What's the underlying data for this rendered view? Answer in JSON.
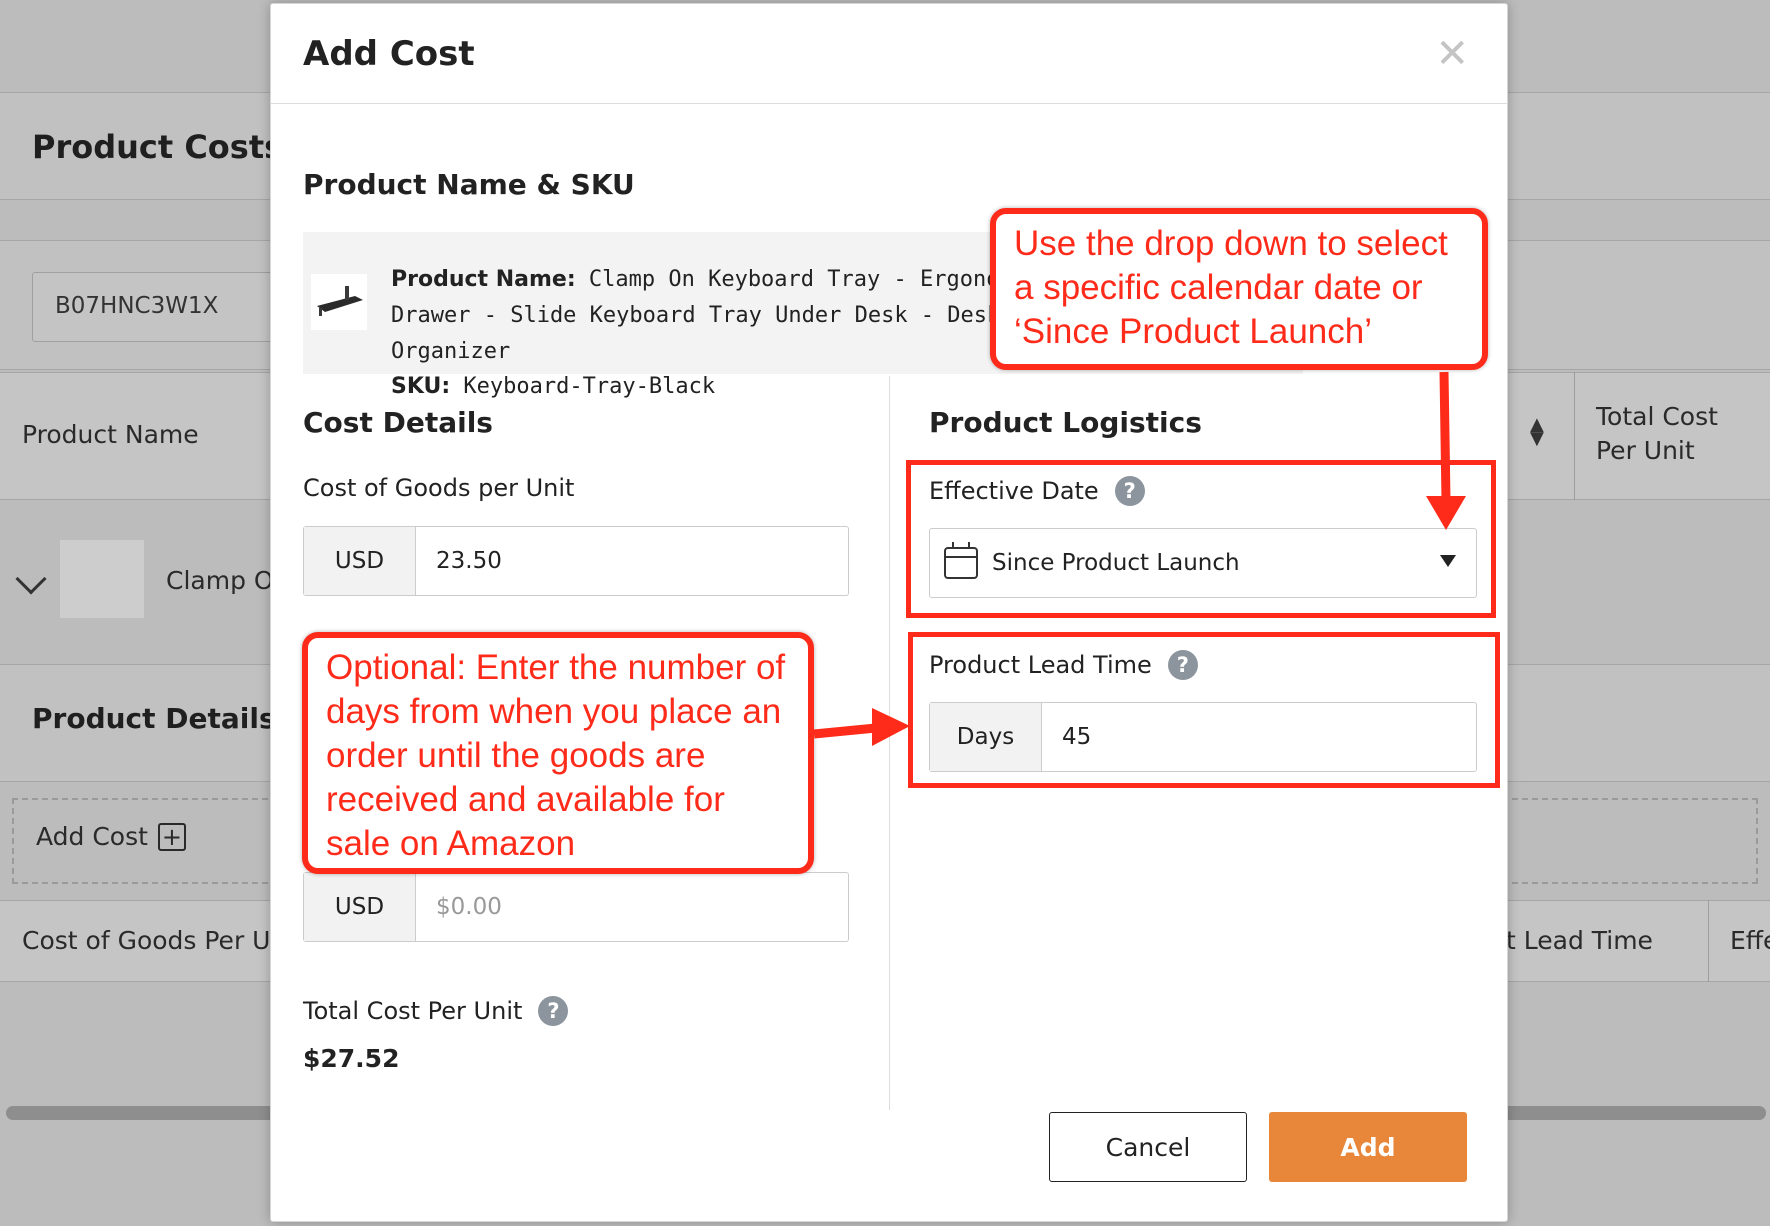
{
  "background": {
    "page_title": "Product Costs",
    "search_value": "B07HNC3W1X",
    "columns": {
      "product_name": "Product Name",
      "total_cost_per_unit": "Total Cost Per Unit"
    },
    "row_product": "Clamp On",
    "details_title": "Product Details",
    "add_cost_label": "Add Cost",
    "bottom_columns": {
      "cost_of_goods": "Cost of Goods Per U",
      "lead_time": "t Lead Time",
      "effective": "Effe"
    }
  },
  "modal": {
    "title": "Add Cost",
    "product_section_title": "Product Name & SKU",
    "product_name_label": "Product Name:",
    "product_name_value": "Clamp On Keyboard Tray - Ergonom Drawer - Slide Keyboard Tray Under Desk - Desk ar Organizer",
    "sku_label": "SKU:",
    "sku_value": "Keyboard-Tray-Black",
    "cost_details_title": "Cost Details",
    "cogs_label": "Cost of Goods per Unit",
    "cogs_currency": "USD",
    "cogs_value": "23.50",
    "second_currency": "USD",
    "second_placeholder": "$0.00",
    "total_label": "Total Cost Per Unit",
    "total_value": "$27.52",
    "logistics_title": "Product Logistics",
    "effective_date_label": "Effective Date",
    "effective_date_value": "Since Product Launch",
    "lead_time_label": "Product Lead Time",
    "lead_time_unit": "Days",
    "lead_time_value": "45",
    "cancel_label": "Cancel",
    "add_label": "Add"
  },
  "annotations": {
    "date_callout": "Use the drop down to select a specific calendar date or ‘Since Product Launch’",
    "lead_callout": "Optional: Enter the number of days from when you place an order until the goods are received and available for sale on Amazon"
  },
  "colors": {
    "accent": "#e8873a",
    "annotation": "#ff2b1a",
    "help": "#8c959d"
  },
  "icons": [
    "close-icon",
    "calendar-icon",
    "caret-down-icon",
    "help-icon",
    "plus-square-icon",
    "chevron-down-icon",
    "sort-icon"
  ]
}
